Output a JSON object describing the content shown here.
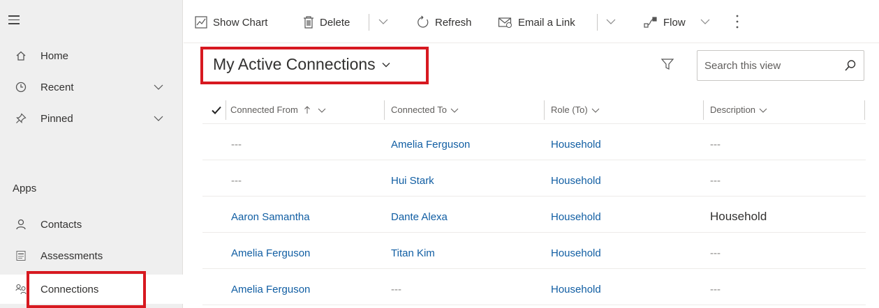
{
  "sidebar": {
    "menu_icon": "hamburger-icon",
    "items": [
      {
        "label": "Home",
        "icon": "home-icon"
      },
      {
        "label": "Recent",
        "icon": "clock-icon"
      },
      {
        "label": "Pinned",
        "icon": "pin-icon"
      }
    ],
    "apps_heading": "Apps",
    "apps": [
      {
        "label": "Contacts",
        "icon": "person-icon"
      },
      {
        "label": "Assessments",
        "icon": "assessment-icon"
      },
      {
        "label": "Connections",
        "icon": "connections-icon"
      }
    ],
    "selected": "Connections"
  },
  "toolbar": {
    "show_chart": "Show Chart",
    "delete": "Delete",
    "refresh": "Refresh",
    "email_link": "Email a Link",
    "flow": "Flow",
    "more_icon": "more-vertical-icon"
  },
  "view": {
    "title": "My Active Connections",
    "search_placeholder": "Search this view"
  },
  "grid": {
    "columns": [
      "Connected From",
      "Connected To",
      "Role (To)",
      "Description"
    ],
    "sort_column": "Connected From",
    "sort_direction": "ascending",
    "rows": [
      {
        "from": "---",
        "to": "Amelia Ferguson",
        "role": "Household",
        "description": "---"
      },
      {
        "from": "---",
        "to": "Hui Stark",
        "role": "Household",
        "description": "---"
      },
      {
        "from": "Aaron Samantha",
        "to": "Dante Alexa",
        "role": "Household",
        "description": "Household"
      },
      {
        "from": "Amelia Ferguson",
        "to": "Titan Kim",
        "role": "Household",
        "description": "---"
      },
      {
        "from": "Amelia Ferguson",
        "to": "---",
        "role": "Household",
        "description": "---"
      }
    ]
  },
  "colors": {
    "link": "#115ea3",
    "highlight": "#d71920",
    "sidebar_bg": "#efefef"
  }
}
